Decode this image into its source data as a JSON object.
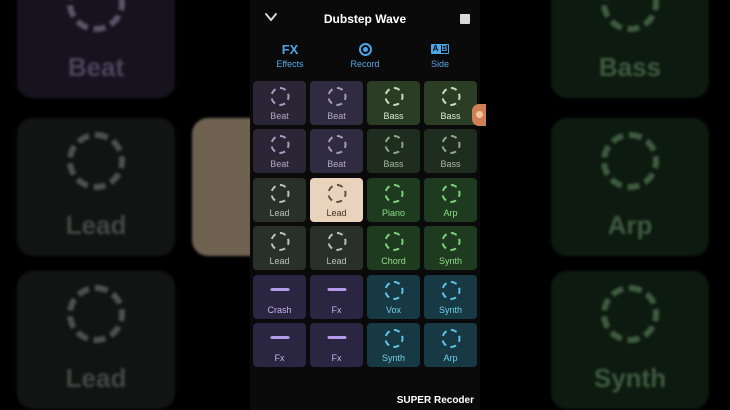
{
  "header": {
    "title": "Dubstep Wave"
  },
  "tabs": [
    {
      "label": "Effects",
      "icon": "fx-icon",
      "icon_text": "FX"
    },
    {
      "label": "Record",
      "icon": "record-icon"
    },
    {
      "label": "Side",
      "icon": "ab-side-icon",
      "icon_a": "A",
      "icon_b": "B"
    }
  ],
  "pads": [
    {
      "label": "Beat",
      "variant": "beat",
      "icon": "dashed-ring-icon"
    },
    {
      "label": "Beat",
      "variant": "beat-hi",
      "icon": "dashed-ring-icon"
    },
    {
      "label": "Bass",
      "variant": "bass",
      "icon": "dashed-ring-icon"
    },
    {
      "label": "Bass",
      "variant": "bass",
      "icon": "dashed-ring-icon"
    },
    {
      "label": "Beat",
      "variant": "beat",
      "icon": "dashed-ring-icon"
    },
    {
      "label": "Beat",
      "variant": "beat-hi",
      "icon": "dashed-ring-icon"
    },
    {
      "label": "Bass",
      "variant": "bass-lo",
      "icon": "dashed-ring-icon"
    },
    {
      "label": "Bass",
      "variant": "bass-lo",
      "icon": "dashed-ring-icon"
    },
    {
      "label": "Lead",
      "variant": "lead",
      "icon": "dashed-ring-icon"
    },
    {
      "label": "Lead",
      "variant": "lead-active",
      "icon": "dashed-ring-icon"
    },
    {
      "label": "Piano",
      "variant": "green",
      "icon": "dashed-ring-icon"
    },
    {
      "label": "Arp",
      "variant": "green",
      "icon": "dashed-ring-icon"
    },
    {
      "label": "Lead",
      "variant": "lead",
      "icon": "dashed-ring-icon"
    },
    {
      "label": "Lead",
      "variant": "lead",
      "icon": "dashed-ring-icon"
    },
    {
      "label": "Chord",
      "variant": "green",
      "icon": "dashed-ring-icon"
    },
    {
      "label": "Synth",
      "variant": "green",
      "icon": "dashed-ring-icon"
    },
    {
      "label": "Crash",
      "variant": "crash",
      "icon": "dash-line-icon"
    },
    {
      "label": "Fx",
      "variant": "crash",
      "icon": "dash-line-icon"
    },
    {
      "label": "Vox",
      "variant": "teal",
      "icon": "dashed-ring-icon"
    },
    {
      "label": "Synth",
      "variant": "teal",
      "icon": "dashed-ring-icon"
    },
    {
      "label": "Fx",
      "variant": "crash",
      "icon": "dash-line-icon"
    },
    {
      "label": "Fx",
      "variant": "crash",
      "icon": "dash-line-icon"
    },
    {
      "label": "Synth",
      "variant": "teal",
      "icon": "dashed-ring-icon"
    },
    {
      "label": "Arp",
      "variant": "teal",
      "icon": "dashed-ring-icon"
    }
  ],
  "background_pads": [
    {
      "label": "Beat",
      "variant": "purple"
    },
    {
      "label": "Bass",
      "variant": "green"
    },
    {
      "label": "Lead",
      "variant": "gray"
    },
    {
      "label": "Arp",
      "variant": "green"
    },
    {
      "label": "Lead",
      "variant": "gray"
    },
    {
      "label": "Synth",
      "variant": "green"
    }
  ],
  "watermark": "SUPER Recoder",
  "colors": {
    "accent": "#4aa6e6",
    "active_pad": "#ead3bd"
  }
}
